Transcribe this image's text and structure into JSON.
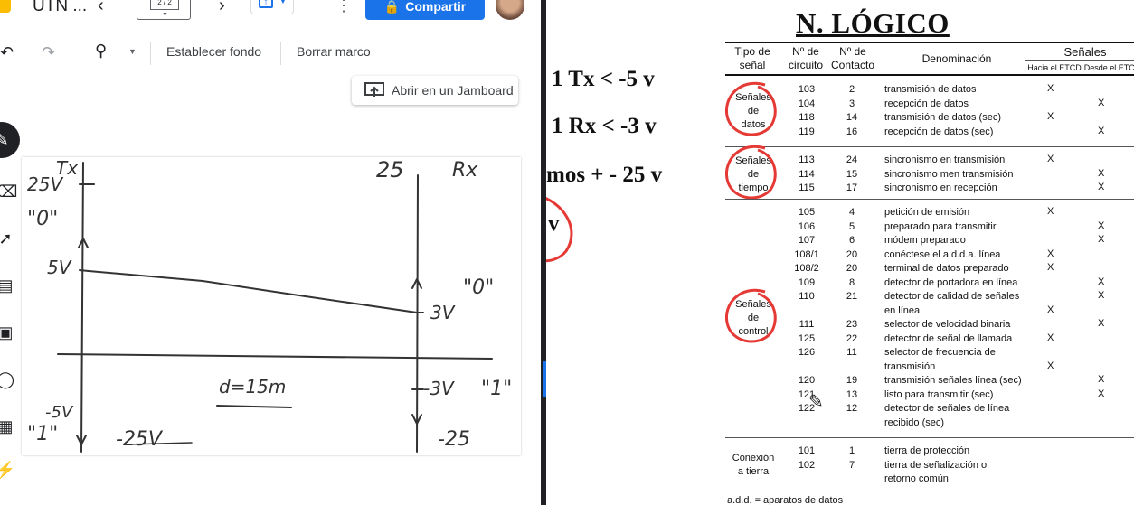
{
  "window": {
    "doc_title": "UTN ...",
    "frame_counter": "2 / 2",
    "share_label": "Compartir"
  },
  "toolbar": {
    "set_background": "Establecer fondo",
    "clear_frame": "Borrar marco"
  },
  "open_in_jamboard": "Abrir en un Jamboard",
  "whiteboard": {
    "label_tx": "Tx",
    "label_rx": "Rx",
    "label_25v": "25V",
    "label_25_right": "25",
    "label_zero_left": "\"0\"",
    "label_5v": "5V",
    "label_zero_right": "\"0\"",
    "label_3v": "3V",
    "label_minus3v": "-3V",
    "label_one_right": "\"1\"",
    "label_distance": "d=15m",
    "label_minus5v": "-5V",
    "label_one_left": "\"1\"",
    "label_minus25v": "-25V",
    "label_minus25": "-25"
  },
  "slide": {
    "line1": "1 Tx < -5 v",
    "line2": "1 Rx < -3 v",
    "line3": "mos   + - 25 v",
    "line4": "v",
    "title": "N. LÓGICO"
  },
  "table": {
    "headers": {
      "tipo": "Tipo de\nseñal",
      "circuito": "Nº de\ncircuito",
      "contacto": "Nº de\nContacto",
      "denominacion": "Denominación",
      "senales": "Señales",
      "hacia": "Hacia el ETCD",
      "desde": "Desde el ETCD"
    },
    "groups": [
      {
        "name": "Señales\nde\ndatos",
        "rows": [
          {
            "circ": "103",
            "cont": "2",
            "den": "transmisión de datos",
            "hacia": "X",
            "desde": ""
          },
          {
            "circ": "104",
            "cont": "3",
            "den": "recepción de datos",
            "hacia": "",
            "desde": "X"
          },
          {
            "circ": "118",
            "cont": "14",
            "den": "transmisión de datos (sec)",
            "hacia": "X",
            "desde": ""
          },
          {
            "circ": "119",
            "cont": "16",
            "den": "recepción de datos (sec)",
            "hacia": "",
            "desde": "X"
          }
        ]
      },
      {
        "name": "Señales\nde\ntiempo",
        "rows": [
          {
            "circ": "113",
            "cont": "24",
            "den": "sincronismo en transmisión",
            "hacia": "X",
            "desde": ""
          },
          {
            "circ": "114",
            "cont": "15",
            "den": "sincronismo men transmisión",
            "hacia": "",
            "desde": "X"
          },
          {
            "circ": "115",
            "cont": "17",
            "den": "sincronismo en recepción",
            "hacia": "",
            "desde": "X"
          }
        ]
      },
      {
        "name": "Señales\nde\ncontrol",
        "rows": [
          {
            "circ": "105",
            "cont": "4",
            "den": "petición de emisión",
            "hacia": "X",
            "desde": ""
          },
          {
            "circ": "106",
            "cont": "5",
            "den": "preparado para transmitir",
            "hacia": "",
            "desde": "X"
          },
          {
            "circ": "107",
            "cont": "6",
            "den": "módem preparado",
            "hacia": "",
            "desde": "X"
          },
          {
            "circ": "108/1",
            "cont": "20",
            "den": "conéctese el a.d.d.a. línea",
            "hacia": "X",
            "desde": ""
          },
          {
            "circ": "108/2",
            "cont": "20",
            "den": "terminal de datos preparado",
            "hacia": "X",
            "desde": ""
          },
          {
            "circ": "109",
            "cont": "8",
            "den": "detector de portadora en línea",
            "hacia": "",
            "desde": "X"
          },
          {
            "circ": "110",
            "cont": "21",
            "den": "detector de calidad de señales",
            "hacia": "",
            "desde": "X"
          },
          {
            "circ": "",
            "cont": "",
            "den": "en línea",
            "hacia": "X",
            "desde": ""
          },
          {
            "circ": "111",
            "cont": "23",
            "den": "selector de velocidad binaria",
            "hacia": "",
            "desde": "X"
          },
          {
            "circ": "125",
            "cont": "22",
            "den": "detector de señal de llamada",
            "hacia": "X",
            "desde": ""
          },
          {
            "circ": "126",
            "cont": "11",
            "den": "selector de frecuencia de",
            "hacia": "",
            "desde": ""
          },
          {
            "circ": "",
            "cont": "",
            "den": "transmisión",
            "hacia": "X",
            "desde": ""
          },
          {
            "circ": "120",
            "cont": "19",
            "den": "transmisión señales línea (sec)",
            "hacia": "",
            "desde": "X"
          },
          {
            "circ": "121",
            "cont": "13",
            "den": "listo para transmitir (sec)",
            "hacia": "",
            "desde": "X"
          },
          {
            "circ": "122",
            "cont": "12",
            "den": "detector de señales de línea",
            "hacia": "",
            "desde": ""
          },
          {
            "circ": "",
            "cont": "",
            "den": "recibido (sec)",
            "hacia": "",
            "desde": ""
          }
        ]
      },
      {
        "name": "Conexión\na tierra",
        "rows": [
          {
            "circ": "101",
            "cont": "1",
            "den": "tierra de protección",
            "hacia": "",
            "desde": ""
          },
          {
            "circ": "102",
            "cont": "7",
            "den": "tierra de señalización o",
            "hacia": "",
            "desde": ""
          },
          {
            "circ": "",
            "cont": "",
            "den": "retorno común",
            "hacia": "",
            "desde": ""
          }
        ]
      }
    ],
    "footnote": "a.d.d. = aparatos de datos"
  },
  "colors": {
    "accent": "#1a73e8",
    "annotation_red": "#e53935",
    "ink": "#333333"
  }
}
